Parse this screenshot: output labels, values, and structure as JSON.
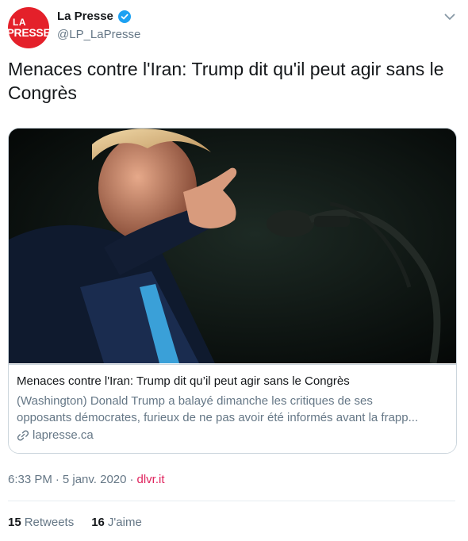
{
  "author": {
    "avatar_line1": "LA",
    "avatar_line2": "PRESSE",
    "name": "La Presse",
    "handle": "@LP_LaPresse",
    "verified": true
  },
  "tweet": {
    "text": "Menaces contre l'Iran: Trump dit qu'il peut agir sans le Congrès"
  },
  "card": {
    "title": "Menaces contre l'Iran: Trump dit qu’il peut agir sans le Congrès",
    "description_line1": "(Washington) Donald Trump a balayé dimanche les critiques de ses",
    "description_line2": "opposants démocrates, furieux de ne pas avoir été informés avant la frapp...",
    "domain": "lapresse.ca",
    "image_icon": "photo-trump-pointing-microphone"
  },
  "meta": {
    "time": "6:33 PM",
    "separator1": "·",
    "date": "5 janv. 2020",
    "separator2": "·",
    "source": "dlvr.it"
  },
  "stats": {
    "retweets_count": "15",
    "retweets_label": "Retweets",
    "likes_count": "16",
    "likes_label": "J'aime"
  },
  "colors": {
    "brand_red": "#e4202a",
    "verified_blue": "#1da1f2",
    "source_pink": "#e0245e",
    "muted_text": "#657786"
  }
}
